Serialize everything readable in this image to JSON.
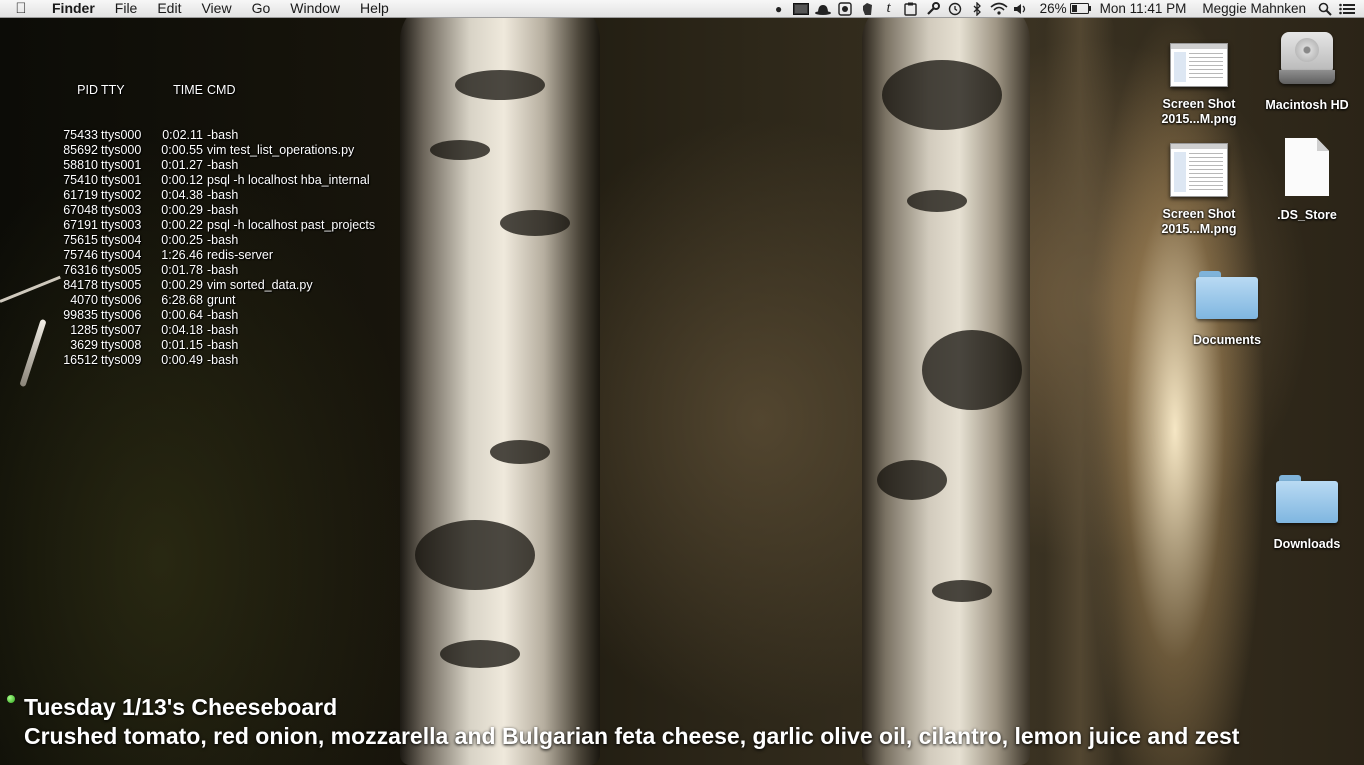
{
  "menubar": {
    "apple_icon": "apple-icon",
    "menus": [
      "Finder",
      "File",
      "Edit",
      "View",
      "Go",
      "Window",
      "Help"
    ],
    "status_icons": [
      "paw-icon",
      "terminal-icon",
      "hat-icon",
      "record-icon",
      "evernote-icon",
      "tumblr-icon",
      "clipboard-icon",
      "wrench-icon",
      "time-machine-icon",
      "bluetooth-icon",
      "wifi-icon",
      "volume-icon"
    ],
    "battery": "26%",
    "clock": "Mon 11:41 PM",
    "user": "Meggie Mahnken"
  },
  "ps": {
    "header": {
      "pid": "PID",
      "tty": "TTY",
      "time": "TIME",
      "cmd": "CMD"
    },
    "rows": [
      {
        "pid": "75433",
        "tty": "ttys000",
        "time": "0:02.11",
        "cmd": "-bash"
      },
      {
        "pid": "85692",
        "tty": "ttys000",
        "time": "0:00.55",
        "cmd": "vim test_list_operations.py"
      },
      {
        "pid": "58810",
        "tty": "ttys001",
        "time": "0:01.27",
        "cmd": "-bash"
      },
      {
        "pid": "75410",
        "tty": "ttys001",
        "time": "0:00.12",
        "cmd": "psql -h localhost hba_internal"
      },
      {
        "pid": "61719",
        "tty": "ttys002",
        "time": "0:04.38",
        "cmd": "-bash"
      },
      {
        "pid": "67048",
        "tty": "ttys003",
        "time": "0:00.29",
        "cmd": "-bash"
      },
      {
        "pid": "67191",
        "tty": "ttys003",
        "time": "0:00.22",
        "cmd": "psql -h localhost past_projects"
      },
      {
        "pid": "75615",
        "tty": "ttys004",
        "time": "0:00.25",
        "cmd": "-bash"
      },
      {
        "pid": "75746",
        "tty": "ttys004",
        "time": "1:26.46",
        "cmd": "redis-server"
      },
      {
        "pid": "76316",
        "tty": "ttys005",
        "time": "0:01.78",
        "cmd": "-bash"
      },
      {
        "pid": "84178",
        "tty": "ttys005",
        "time": "0:00.29",
        "cmd": "vim sorted_data.py"
      },
      {
        "pid": "4070",
        "tty": "ttys006",
        "time": "6:28.68",
        "cmd": "grunt"
      },
      {
        "pid": "99835",
        "tty": "ttys006",
        "time": "0:00.64",
        "cmd": "-bash"
      },
      {
        "pid": "1285",
        "tty": "ttys007",
        "time": "0:04.18",
        "cmd": "-bash"
      },
      {
        "pid": "3629",
        "tty": "ttys008",
        "time": "0:01.15",
        "cmd": "-bash"
      },
      {
        "pid": "16512",
        "tty": "ttys009",
        "time": "0:00.49",
        "cmd": "-bash"
      }
    ]
  },
  "desktop": {
    "icons": [
      {
        "label_line1": "Screen Shot",
        "label_line2": "2015...M.png",
        "icon": "screenshot-thumbnail-icon"
      },
      {
        "label_line1": "Macintosh HD",
        "icon": "hard-drive-icon"
      },
      {
        "label_line1": "Screen Shot",
        "label_line2": "2015...M.png",
        "icon": "screenshot-thumbnail-icon"
      },
      {
        "label_line1": ".DS_Store",
        "icon": "document-icon"
      },
      {
        "label_line1": "Documents",
        "icon": "folder-icon"
      },
      {
        "label_line1": "Downloads",
        "icon": "folder-icon"
      }
    ]
  },
  "cheeseboard": {
    "title": "Tuesday 1/13's Cheeseboard",
    "description": "Crushed tomato, red onion, mozzarella and Bulgarian feta cheese, garlic olive oil, cilantro, lemon juice and zest"
  }
}
